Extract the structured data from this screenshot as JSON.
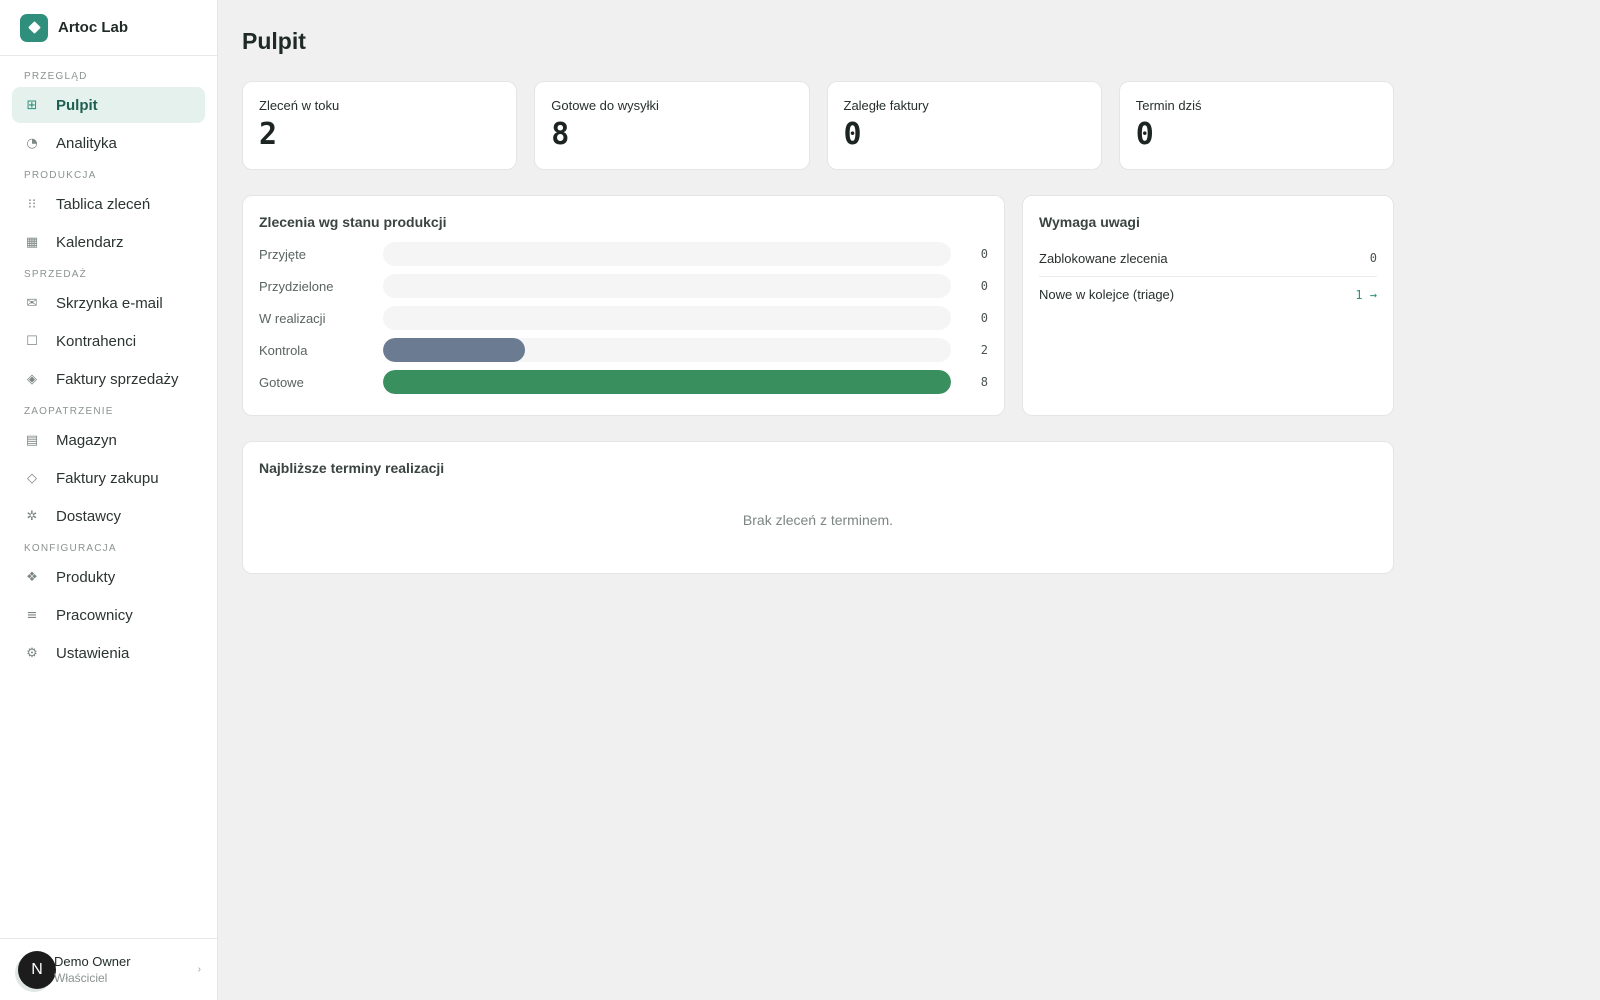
{
  "brand": {
    "name": "Artoc Lab"
  },
  "sidebar": {
    "sections": [
      {
        "title": "PRZEGLĄD",
        "items": [
          {
            "label": "Pulpit",
            "icon": "grid-icon",
            "glyph": "⊞",
            "active": true
          },
          {
            "label": "Analityka",
            "icon": "pie-chart-icon",
            "glyph": "◔"
          }
        ]
      },
      {
        "title": "PRODUKCJA",
        "items": [
          {
            "label": "Tablica zleceń",
            "icon": "board-icon",
            "glyph": "⁝⁝"
          },
          {
            "label": "Kalendarz",
            "icon": "calendar-icon",
            "glyph": "▦"
          }
        ]
      },
      {
        "title": "SPRZEDAŻ",
        "items": [
          {
            "label": "Skrzynka e-mail",
            "icon": "mail-icon",
            "glyph": "✉"
          },
          {
            "label": "Kontrahenci",
            "icon": "contacts-icon",
            "glyph": "☐"
          },
          {
            "label": "Faktury sprzedaży",
            "icon": "invoice-icon",
            "glyph": "◈"
          }
        ]
      },
      {
        "title": "ZAOPATRZENIE",
        "items": [
          {
            "label": "Magazyn",
            "icon": "warehouse-icon",
            "glyph": "▤"
          },
          {
            "label": "Faktury zakupu",
            "icon": "purchase-invoice-icon",
            "glyph": "◇"
          },
          {
            "label": "Dostawcy",
            "icon": "suppliers-icon",
            "glyph": "✲"
          }
        ]
      },
      {
        "title": "KONFIGURACJA",
        "items": [
          {
            "label": "Produkty",
            "icon": "products-icon",
            "glyph": "❖"
          },
          {
            "label": "Pracownicy",
            "icon": "employees-icon",
            "glyph": "≡"
          },
          {
            "label": "Ustawienia",
            "icon": "settings-icon",
            "glyph": "⚙"
          }
        ]
      }
    ]
  },
  "user": {
    "initial": "N",
    "name": "Demo Owner",
    "role": "Właściciel"
  },
  "page": {
    "title": "Pulpit"
  },
  "kpis": [
    {
      "label": "Zleceń w toku",
      "value": "2"
    },
    {
      "label": "Gotowe do wysyłki",
      "value": "8"
    },
    {
      "label": "Zaległe faktury",
      "value": "0"
    },
    {
      "label": "Termin dziś",
      "value": "0"
    }
  ],
  "production_status": {
    "title": "Zlecenia wg stanu produkcji",
    "max": 8,
    "rows": [
      {
        "label": "Przyjęte",
        "value": 0,
        "color": "#6b7b92"
      },
      {
        "label": "Przydzielone",
        "value": 0,
        "color": "#6b7b92"
      },
      {
        "label": "W realizacji",
        "value": 0,
        "color": "#6b7b92"
      },
      {
        "label": "Kontrola",
        "value": 2,
        "color": "#6b7b92"
      },
      {
        "label": "Gotowe",
        "value": 8,
        "color": "#3a8f5f"
      }
    ]
  },
  "attention": {
    "title": "Wymaga uwagi",
    "rows": [
      {
        "label": "Zablokowane zlecenia",
        "value": "0",
        "link": false
      },
      {
        "label": "Nowe w kolejce (triage)",
        "value": "1 →",
        "link": true
      }
    ]
  },
  "deadlines": {
    "title": "Najbliższe terminy realizacji",
    "empty": "Brak zleceń z terminem."
  },
  "colors": {
    "accent": "#2f8f7c",
    "active_bg": "#e4f1ed"
  }
}
